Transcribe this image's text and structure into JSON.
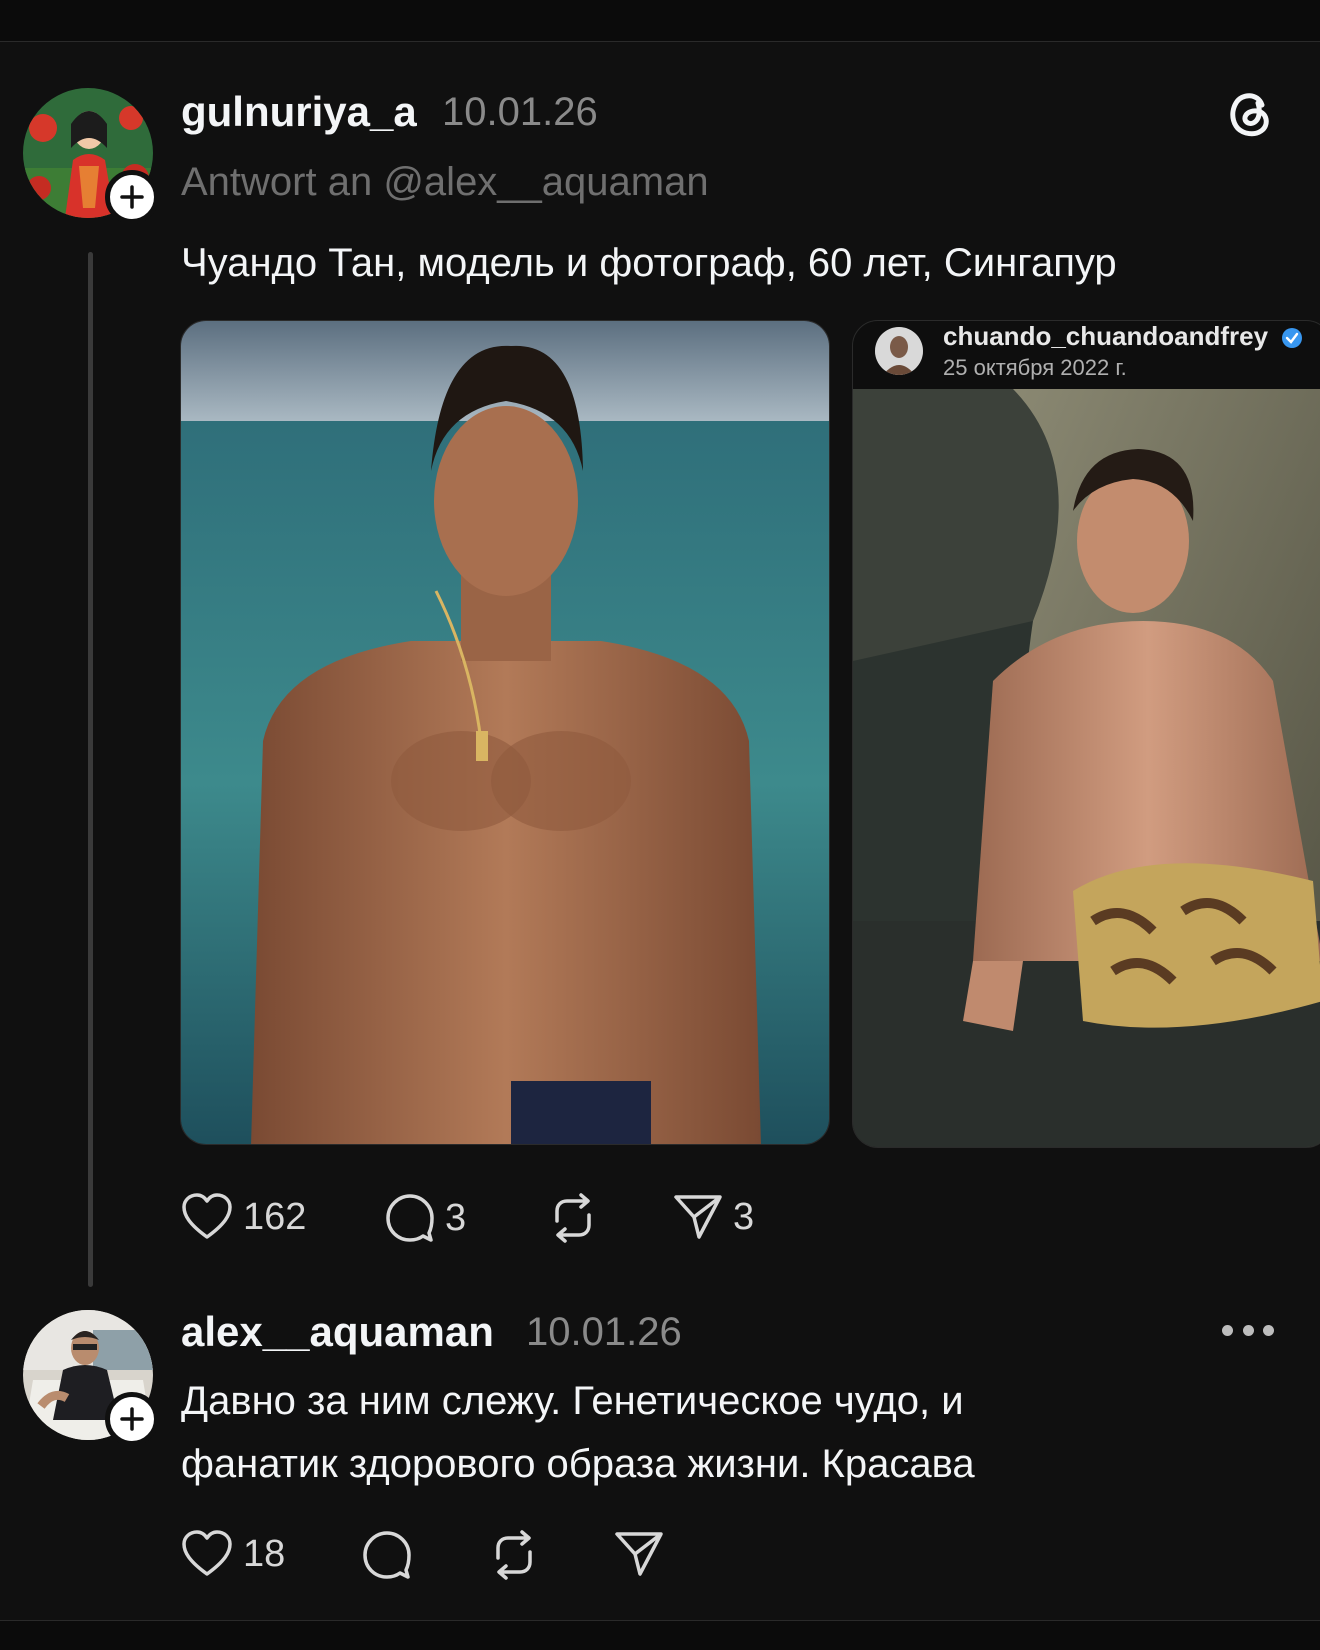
{
  "post": {
    "username": "gulnuriya_a",
    "date": "10.01.26",
    "reply_to": "Antwort an @alex__aquaman",
    "text": "Чуандо Тан, модель и фотограф, 60 лет, Сингапур",
    "likes": "162",
    "comments": "3",
    "shares": "3",
    "embed": {
      "username": "chuando_chuandoandfrey",
      "date": "25 октября 2022 г."
    }
  },
  "reply": {
    "username": "alex__aquaman",
    "date": "10.01.26",
    "text_line1": "Давно за ним слежу. Генетическое чудо, и",
    "text_line2": "фанатик здорового образа жизни. Красава",
    "likes": "18"
  },
  "icons": {
    "like": "heart-icon",
    "comment": "comment-icon",
    "repost": "repost-icon",
    "share": "send-icon",
    "follow": "plus-icon",
    "brand": "threads-logo-icon",
    "menu": "more-icon"
  },
  "colors": {
    "background": "#101010",
    "text": "#f3f5f7",
    "muted": "#8a8a8a",
    "verified": "#3897f0"
  }
}
